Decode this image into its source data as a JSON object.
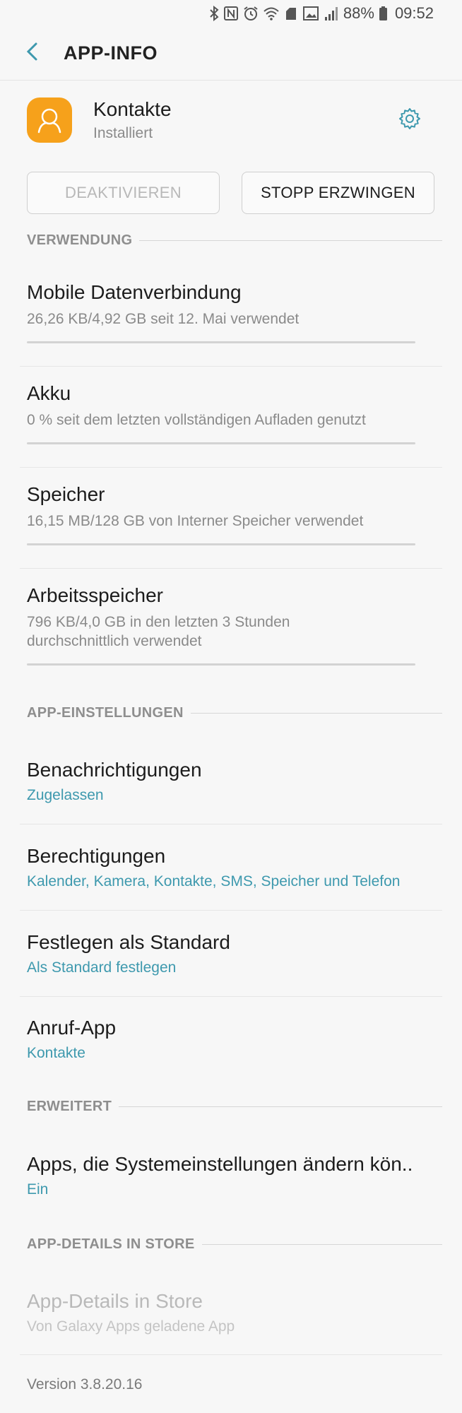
{
  "status_bar": {
    "battery": "88%",
    "time": "09:52",
    "icons": [
      "bluetooth-icon",
      "nfc-icon",
      "alarm-icon",
      "wifi-icon",
      "data-saver-icon",
      "screenshot-icon",
      "signal-icon",
      "battery-icon"
    ]
  },
  "header": {
    "title": "APP-INFO"
  },
  "app": {
    "name": "Kontakte",
    "status": "Installiert",
    "icon_color": "#f6a11b"
  },
  "buttons": {
    "disable": "DEAKTIVIEREN",
    "force_stop": "STOPP ERZWINGEN"
  },
  "sections": {
    "usage": "VERWENDUNG",
    "app_settings": "APP-EINSTELLUNGEN",
    "advanced": "ERWEITERT",
    "store": "APP-DETAILS IN STORE"
  },
  "usage_items": [
    {
      "title": "Mobile Datenverbindung",
      "sub": "26,26 KB/4,92 GB seit 12. Mai verwendet",
      "fraction": 0.0
    },
    {
      "title": "Akku",
      "sub": "0 % seit dem letzten vollständigen Aufladen genutzt",
      "fraction": 0.0
    },
    {
      "title": "Speicher",
      "sub": "16,15 MB/128 GB von Interner Speicher verwendet",
      "fraction": 0.0
    },
    {
      "title": "Arbeitsspeicher",
      "sub_line1": "796 KB/4,0 GB in den letzten 3 Stunden",
      "sub_line2": "durchschnittlich verwendet",
      "fraction": 0.0
    }
  ],
  "settings_items": [
    {
      "title": "Benachrichtigungen",
      "value": "Zugelassen"
    },
    {
      "title": "Berechtigungen",
      "value": "Kalender, Kamera, Kontakte, SMS, Speicher und Telefon"
    },
    {
      "title": "Festlegen als Standard",
      "value": "Als Standard festlegen"
    },
    {
      "title": "Anruf-App",
      "value": "Kontakte"
    }
  ],
  "advanced_items": [
    {
      "title": "Apps, die Systemeinstellungen ändern kön..",
      "value": "Ein"
    }
  ],
  "store": {
    "title": "App-Details in Store",
    "sub": "Von Galaxy Apps geladene App"
  },
  "version": "Version 3.8.20.16",
  "colors": {
    "accent": "#3e99ae",
    "background": "#f7f7f7"
  }
}
